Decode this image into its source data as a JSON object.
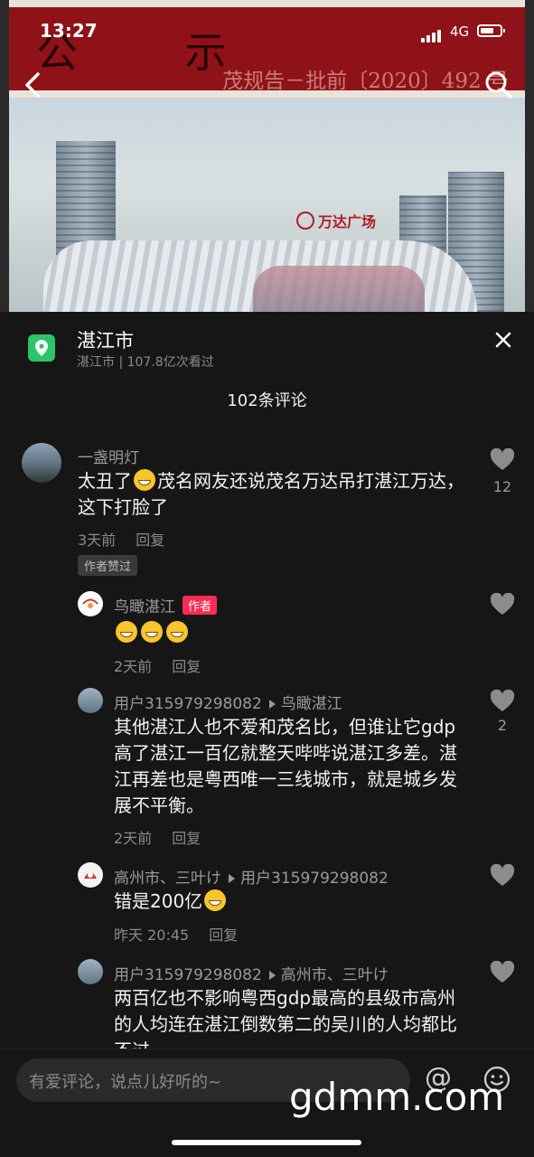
{
  "status": {
    "time": "13:27",
    "network": "4G"
  },
  "poster": {
    "big_title": "公 示",
    "doc_number": "茂规告－批前〔2020〕492 号",
    "mall_sign": "万达广场"
  },
  "sheet": {
    "location_name": "湛江市",
    "location_meta": "湛江市 | 107.8亿次看过",
    "comment_count": "102条评论"
  },
  "comments": [
    {
      "user": "一盏明灯",
      "text_a": "太丑了",
      "text_b": "茂名网友还说茂名万达吊打湛江万达，这下打脸了",
      "time": "3天前",
      "reply": "回复",
      "likes": "12",
      "badge": "作者赞过"
    },
    {
      "user": "鸟瞰湛江",
      "tag": "作者",
      "time": "2天前",
      "reply": "回复"
    },
    {
      "user": "用户315979298082",
      "reply_to": "鸟瞰湛江",
      "text": "其他湛江人也不爱和茂名比，但谁让它gdp高了湛江一百亿就整天哔哔说湛江多差。湛江再差也是粤西唯一三线城市，就是城乡发展不平衡。",
      "time": "2天前",
      "reply": "回复",
      "likes": "2"
    },
    {
      "user": "高州市、三叶け",
      "reply_to": "用户315979298082",
      "text": "错是200亿",
      "time": "昨天 20:45",
      "reply": "回复"
    },
    {
      "user": "用户315979298082",
      "reply_to": "高州市、三叶け",
      "text": "两百亿也不影响粤西gdp最高的县级市高州的人均连在湛江倒数第二的吴川的人均都比不过"
    }
  ],
  "input": {
    "placeholder": "有爱评论，说点儿好听的~",
    "at": "@"
  },
  "watermark": "gdmm.com",
  "colors": {
    "accent_red": "#fe2c55",
    "location_green": "#2cc36b",
    "banner_red": "#8f1218"
  }
}
